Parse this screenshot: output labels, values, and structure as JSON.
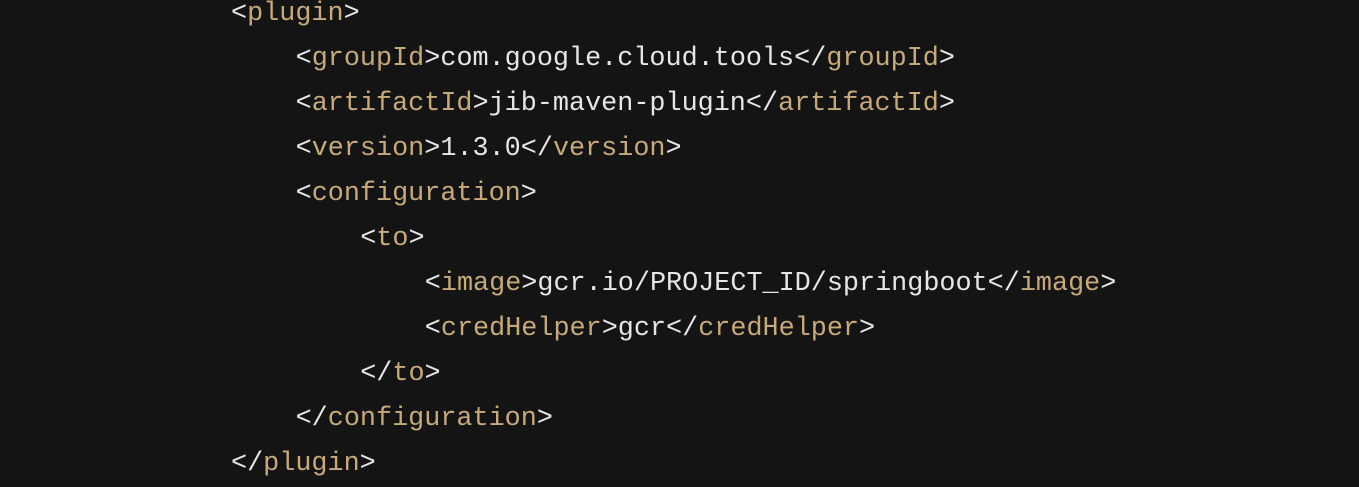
{
  "code": {
    "lines": [
      {
        "open": "<",
        "tag": "plugin",
        "close": ">"
      },
      {
        "open": "<",
        "tag": "groupId",
        "close": ">",
        "text": "com.google.cloud.tools",
        "end_open": "</",
        "end_tag": "groupId",
        "end_close": ">"
      },
      {
        "open": "<",
        "tag": "artifactId",
        "close": ">",
        "text": "jib-maven-plugin",
        "end_open": "</",
        "end_tag": "artifactId",
        "end_close": ">"
      },
      {
        "open": "<",
        "tag": "version",
        "close": ">",
        "text": "1.3.0",
        "end_open": "</",
        "end_tag": "version",
        "end_close": ">"
      },
      {
        "open": "<",
        "tag": "configuration",
        "close": ">"
      },
      {
        "open": "<",
        "tag": "to",
        "close": ">"
      },
      {
        "open": "<",
        "tag": "image",
        "close": ">",
        "text": "gcr.io/PROJECT_ID/springboot",
        "end_open": "</",
        "end_tag": "image",
        "end_close": ">"
      },
      {
        "open": "<",
        "tag": "credHelper",
        "close": ">",
        "text": "gcr",
        "end_open": "</",
        "end_tag": "credHelper",
        "end_close": ">"
      },
      {
        "open": "</",
        "tag": "to",
        "close": ">"
      },
      {
        "open": "</",
        "tag": "configuration",
        "close": ">"
      },
      {
        "open": "</",
        "tag": "plugin",
        "close": ">"
      }
    ]
  },
  "colors": {
    "background": "#141414",
    "tag": "#c8a97a",
    "text": "#e6e6e6"
  }
}
